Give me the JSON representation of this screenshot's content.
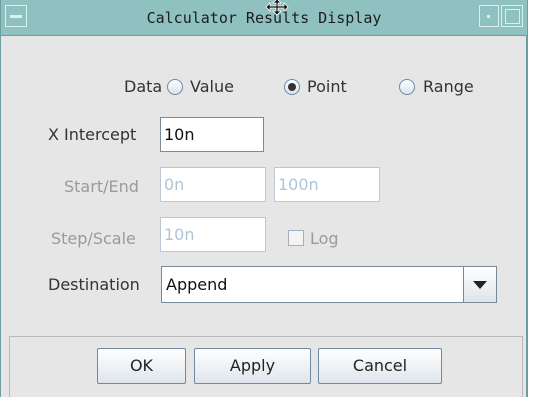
{
  "window": {
    "title": "Calculator Results Display"
  },
  "data_group": {
    "label": "Data",
    "options": [
      {
        "label": "Value",
        "selected": false
      },
      {
        "label": "Point",
        "selected": true
      },
      {
        "label": "Range",
        "selected": false
      }
    ]
  },
  "x_intercept": {
    "label": "X Intercept",
    "value": "10n"
  },
  "start_end": {
    "label": "Start/End",
    "start": "0n",
    "end": "100n",
    "enabled": false
  },
  "step_scale": {
    "label": "Step/Scale",
    "value": "10n",
    "log_label": "Log",
    "log_checked": false,
    "enabled": false
  },
  "destination": {
    "label": "Destination",
    "selected": "Append"
  },
  "buttons": {
    "ok": "OK",
    "apply": "Apply",
    "cancel": "Cancel"
  }
}
